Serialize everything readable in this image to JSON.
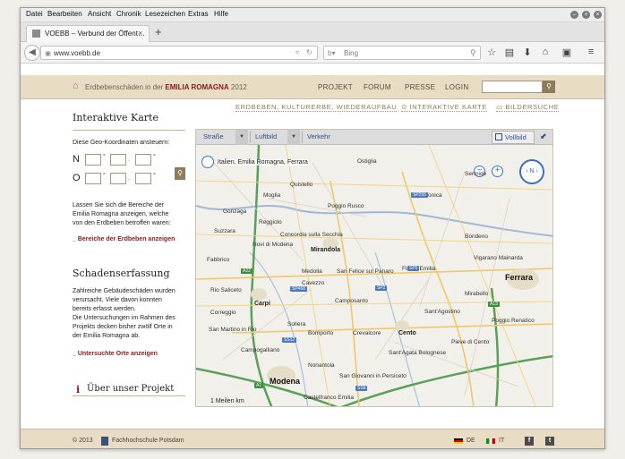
{
  "browser": {
    "menu": [
      "Datei",
      "Bearbeiten",
      "Ansicht",
      "Chronik",
      "Lesezeichen",
      "Extras",
      "Hilfe"
    ],
    "tab_title": "VOEBB – Verbund der Öffent…",
    "tab_close": "×",
    "new_tab": "+",
    "url": "www.voebb.de",
    "search_placeholder": "Bing"
  },
  "header": {
    "title_prefix": "Erdbebenschäden in der",
    "title_region": "EMILIA ROMAGNA",
    "title_year": "2012",
    "nav": [
      "PROJEKT",
      "FORUM",
      "PRESSE",
      "LOGIN"
    ]
  },
  "subnav": {
    "link1": "ERDBEBEN, KULTURERBE, WIEDERAUFBAU",
    "link2": "INTERAKTIVE KARTE",
    "link3": "BILDERSUCHE"
  },
  "left": {
    "map_title": "Interaktive Karte",
    "geo_label": "Diese Geo-Koordinaten ansteuern:",
    "north": "N",
    "east": "O",
    "deg1": "°",
    "deg2": ".",
    "deg3": "°",
    "areas_text1": "Lassen Sie sich die Bereiche der",
    "areas_text2": "Emilia Romagna anzeigen, welche",
    "areas_text3": "von den Erdbeben betroffen waren:",
    "areas_link": "_ Bereiche der Erdbeben anzeigen",
    "damage_title": "Schadenserfassung",
    "damage_text1": "Zahlreiche Gebäudeschäden wurden",
    "damage_text2": "verursacht. Viele davon konnten",
    "damage_text3": "bereits erfasst werden.",
    "damage_text4": "Die Untersuchungen im Rahmen des",
    "damage_text5": "Projekts decken bisher zwölf Orte in",
    "damage_text6": "der Emilia Romagna ab.",
    "places_link": "_ Untersuchte Orte anzeigen",
    "about_icon": "i",
    "about_label": "Über unser Projekt"
  },
  "map": {
    "toolbar": {
      "road": "Straße",
      "aerial": "Luftbild",
      "traffic": "Verkehr",
      "fullscreen": "Vollbild"
    },
    "location_label": "Italien, Emilia Romagna, Ferrara",
    "scale_label": "1 Meilen",
    "scale_unit": "km",
    "places_major": [
      "Modena",
      "Ferrara"
    ],
    "places_mid": [
      "Mirandola",
      "Cento",
      "Carpi",
      "Finale Emilia"
    ],
    "places": [
      "Gonzaga",
      "Poggio Rusco",
      "Novi di Modena",
      "Concordia sulla Secchia",
      "Medolla",
      "Cavezzo",
      "San Felice sul Panaro",
      "Camposanto",
      "Rio Saliceto",
      "Correggio",
      "Soliera",
      "Bomporto",
      "Crevalcore",
      "Nonantola",
      "San Giovanni in Persiceto",
      "Castelfranco Emilia",
      "Pieve di Cento",
      "Vigarano Mainarda",
      "Bondeno",
      "Sermide",
      "Felonica",
      "Suzzara",
      "Fabbrico",
      "San Martino in Rio",
      "Campogalliano",
      "Sant'Agostino",
      "Poggio Renatico",
      "Mirabello",
      "Ostiglia",
      "Quistello",
      "Moglia",
      "Reggiolo",
      "Sant'Agata Bolognese"
    ],
    "shields": [
      "A22",
      "SS12",
      "SP468",
      "SP2",
      "SP5",
      "A1",
      "A13",
      "SS9",
      "SP255"
    ]
  },
  "footer": {
    "copyright": "© 2013",
    "institution": "Fachhochschule Potsdam",
    "lang_de": "DE",
    "lang_it": "IT",
    "fb": "f",
    "tw": "t"
  },
  "colors": {
    "header_bg": "#e8dcc4",
    "accent_red": "#8b1a1a",
    "link_blue": "#2a4f8c"
  }
}
